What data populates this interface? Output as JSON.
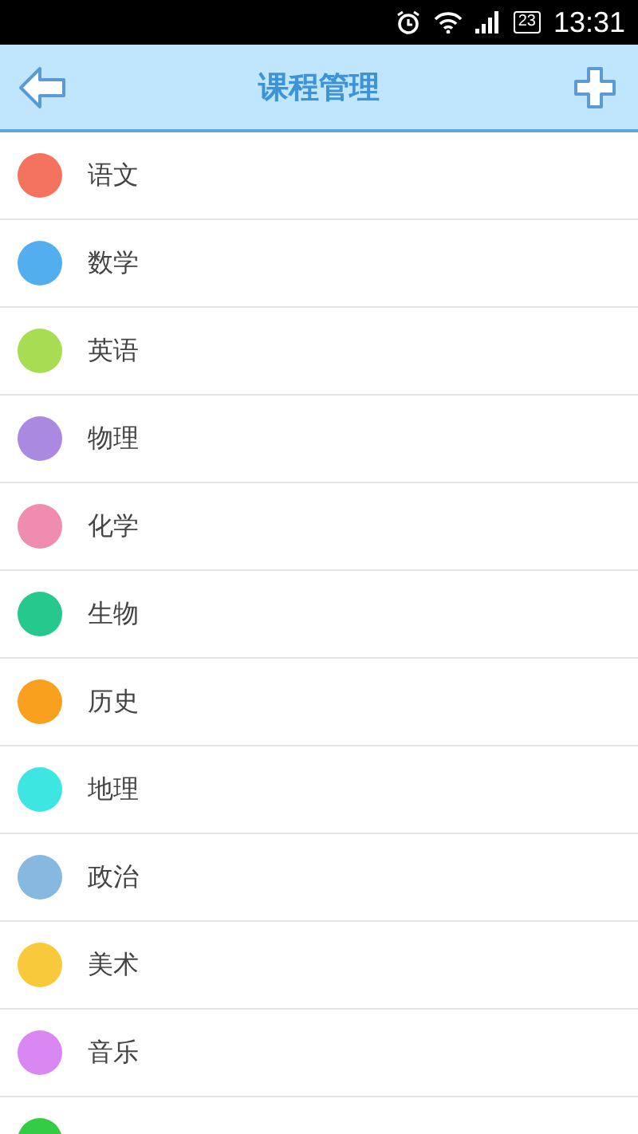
{
  "status_bar": {
    "battery": "23",
    "time": "13:31"
  },
  "header": {
    "title": "课程管理"
  },
  "courses": [
    {
      "name": "语文",
      "color": "#f4735e"
    },
    {
      "name": "数学",
      "color": "#53aef0"
    },
    {
      "name": "英语",
      "color": "#a8dc52"
    },
    {
      "name": "物理",
      "color": "#a98ae0"
    },
    {
      "name": "化学",
      "color": "#f08cb0"
    },
    {
      "name": "生物",
      "color": "#25c98e"
    },
    {
      "name": "历史",
      "color": "#f9a11e"
    },
    {
      "name": "地理",
      "color": "#3ee6e2"
    },
    {
      "name": "政治",
      "color": "#86b8e0"
    },
    {
      "name": "美术",
      "color": "#f8c93a"
    },
    {
      "name": "音乐",
      "color": "#d987f3"
    },
    {
      "color": "#33cc44"
    }
  ]
}
